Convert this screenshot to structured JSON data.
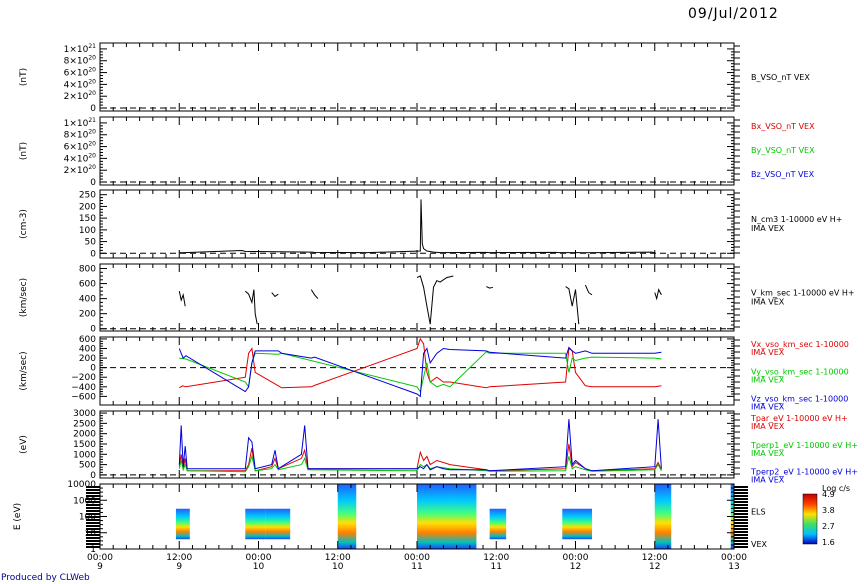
{
  "date": "09/Jul/2012",
  "credit": "Produced by CLWeb",
  "colors": {
    "red": "#e00000",
    "green": "#00c800",
    "blue": "#0000dc",
    "black": "#000000"
  },
  "time_axis": {
    "hours": [
      "00:00",
      "12:00",
      "00:00",
      "12:00",
      "00:00",
      "12:00",
      "00:00",
      "12:00",
      "00:00"
    ],
    "days": [
      "9",
      "9",
      "10",
      "10",
      "11",
      "11",
      "12",
      "12",
      "13"
    ],
    "start": "2012-07-09T00:00",
    "end": "2012-07-13T00:00"
  },
  "chart_data": [
    {
      "type": "line",
      "ylabel": "(nT)",
      "ylim": [
        -5e+19,
        1.1e+21
      ],
      "yticks": [
        {
          "v": 1e+21,
          "base": "1×10",
          "exp": "21"
        },
        {
          "v": 8e+20,
          "base": "8×10",
          "exp": "20"
        },
        {
          "v": 6e+20,
          "base": "6×10",
          "exp": "20"
        },
        {
          "v": 4e+20,
          "base": "4×10",
          "exp": "20"
        },
        {
          "v": 2e+20,
          "base": "2×10",
          "exp": "20"
        },
        {
          "v": 0,
          "base": "0",
          "exp": ""
        }
      ],
      "legend": [
        {
          "name": "B_VSO_nT VEX",
          "color": "black"
        }
      ],
      "series": []
    },
    {
      "type": "line",
      "ylabel": "(nT)",
      "ylim": [
        -5e+19,
        1.1e+21
      ],
      "yticks": [
        {
          "v": 1e+21,
          "base": "1×10",
          "exp": "21"
        },
        {
          "v": 8e+20,
          "base": "8×10",
          "exp": "20"
        },
        {
          "v": 6e+20,
          "base": "6×10",
          "exp": "20"
        },
        {
          "v": 4e+20,
          "base": "4×10",
          "exp": "20"
        },
        {
          "v": 2e+20,
          "base": "2×10",
          "exp": "20"
        },
        {
          "v": 0,
          "base": "0",
          "exp": ""
        }
      ],
      "legend": [
        {
          "name": "Bx_VSO_nT VEX",
          "color": "red"
        },
        {
          "name": "By_VSO_nT VEX",
          "color": "green"
        },
        {
          "name": "Bz_VSO_nT VEX",
          "color": "blue"
        }
      ],
      "series": []
    },
    {
      "type": "line",
      "ylabel": "(cm-3)",
      "ylim": [
        -20,
        270
      ],
      "yticks": [
        {
          "v": 250,
          "base": "250"
        },
        {
          "v": 200,
          "base": "200"
        },
        {
          "v": 150,
          "base": "150"
        },
        {
          "v": 100,
          "base": "100"
        },
        {
          "v": 50,
          "base": "50"
        },
        {
          "v": 0,
          "base": "0"
        }
      ],
      "legend": [
        {
          "name": "N_cm3 1-10000 eV H+",
          "color": "black"
        },
        {
          "name": "IMA VEX",
          "color": "black"
        }
      ],
      "series": [
        {
          "name": "N",
          "color": "black",
          "t": [
            12.0,
            12.3,
            21.5,
            22.0,
            32.0,
            32.5,
            40.0,
            40.5,
            48.5,
            48.6,
            48.8,
            49.0,
            49.5,
            50.5,
            51.5,
            58.5,
            59.0,
            69.0,
            69.5,
            72.5,
            73.0,
            83.5,
            84.0
          ],
          "y": [
            3,
            2,
            12,
            8,
            5,
            4,
            3,
            3,
            10,
            230,
            40,
            20,
            10,
            5,
            3,
            4,
            3,
            4,
            3,
            3,
            2,
            5,
            3
          ]
        }
      ]
    },
    {
      "type": "line",
      "ylabel": "(km/sec)",
      "ylim": [
        -30,
        860
      ],
      "yticks": [
        {
          "v": 800,
          "base": "800"
        },
        {
          "v": 600,
          "base": "600"
        },
        {
          "v": 400,
          "base": "400"
        },
        {
          "v": 200,
          "base": "200"
        },
        {
          "v": 0,
          "base": "0"
        }
      ],
      "legend": [
        {
          "name": "V_km_sec 1-10000 eV H+",
          "color": "black"
        },
        {
          "name": "IMA VEX",
          "color": "black"
        }
      ],
      "series": [
        {
          "name": "V",
          "color": "black",
          "t": [
            12.0,
            12.3,
            12.6,
            12.9
          ],
          "y": [
            500,
            380,
            450,
            300
          ]
        },
        {
          "name": "V",
          "color": "black",
          "t": [
            22.0,
            22.5,
            23.0,
            23.3,
            23.5,
            23.8
          ],
          "y": [
            500,
            460,
            350,
            520,
            200,
            60
          ]
        },
        {
          "name": "V",
          "color": "black",
          "t": [
            26.0,
            26.5,
            27.0
          ],
          "y": [
            480,
            430,
            460
          ]
        },
        {
          "name": "V",
          "color": "black",
          "t": [
            32.0,
            32.5,
            33.0
          ],
          "y": [
            520,
            450,
            400
          ]
        },
        {
          "name": "V",
          "color": "black",
          "t": [
            48.0,
            48.5,
            49.0,
            49.5,
            50.0,
            50.5,
            51.0,
            51.5,
            52.5,
            53.5
          ],
          "y": [
            680,
            700,
            550,
            300,
            60,
            550,
            640,
            620,
            680,
            700
          ]
        },
        {
          "name": "V",
          "color": "black",
          "t": [
            58.5,
            59.0,
            59.5
          ],
          "y": [
            560,
            540,
            550
          ]
        },
        {
          "name": "V",
          "color": "black",
          "t": [
            70.5,
            71.0,
            71.5,
            72.0,
            72.5
          ],
          "y": [
            560,
            530,
            300,
            520,
            60
          ]
        },
        {
          "name": "V",
          "color": "black",
          "t": [
            73.5,
            74.0,
            74.5
          ],
          "y": [
            580,
            480,
            450
          ]
        },
        {
          "name": "V",
          "color": "black",
          "t": [
            84.0,
            84.3,
            84.6,
            85.0
          ],
          "y": [
            480,
            400,
            520,
            450
          ]
        }
      ]
    },
    {
      "type": "line",
      "ylabel": "(km/sec)",
      "ylim": [
        -780,
        640
      ],
      "yticks": [
        {
          "v": 600,
          "base": "600"
        },
        {
          "v": 400,
          "base": "400"
        },
        {
          "v": 200,
          "base": "200"
        },
        {
          "v": 0,
          "base": "0"
        },
        {
          "v": -200,
          "base": "−200"
        },
        {
          "v": -400,
          "base": "−400"
        },
        {
          "v": -600,
          "base": "−600"
        }
      ],
      "legend": [
        {
          "name": "Vx_vso_km_sec 1-10000",
          "color": "red"
        },
        {
          "name": "IMA VEX",
          "color": "red"
        },
        {
          "name": "Vy_vso_km_sec 1-10000",
          "color": "green"
        },
        {
          "name": "IMA VEX",
          "color": "green"
        },
        {
          "name": "Vz_vso_km_sec 1-10000",
          "color": "blue"
        },
        {
          "name": "IMA VEX",
          "color": "blue"
        }
      ],
      "series": [
        {
          "name": "Vx",
          "color": "red",
          "t": [
            12.0,
            12.5,
            13.0,
            22.0,
            22.5,
            23.0,
            23.5,
            27.0,
            27.5,
            32.0,
            32.5,
            48.0,
            48.5,
            49.0,
            49.5,
            50.0,
            51.0,
            52.0,
            53.0,
            58.5,
            59.0,
            70.5,
            71.0,
            71.5,
            72.0,
            73.5,
            74.5,
            84.0,
            85.0
          ],
          "y": [
            -420,
            -380,
            -400,
            -200,
            300,
            400,
            -100,
            -380,
            -420,
            -400,
            -370,
            400,
            600,
            500,
            -100,
            -300,
            -200,
            -300,
            -300,
            -420,
            -400,
            -300,
            400,
            350,
            -100,
            -380,
            -400,
            -400,
            -380
          ]
        },
        {
          "name": "Vy",
          "color": "green",
          "t": [
            12.0,
            13.0,
            22.0,
            22.5,
            23.0,
            23.5,
            27.0,
            27.5,
            48.0,
            48.5,
            49.0,
            49.5,
            50.0,
            51.0,
            52.0,
            53.0,
            58.5,
            59.0,
            70.5,
            71.0,
            71.5,
            72.0,
            73.5,
            74.5,
            84.0,
            85.0
          ],
          "y": [
            200,
            180,
            -300,
            -400,
            100,
            300,
            280,
            300,
            -400,
            -500,
            -200,
            100,
            -300,
            -400,
            -350,
            -400,
            330,
            300,
            300,
            -100,
            200,
            150,
            200,
            220,
            200,
            180
          ]
        },
        {
          "name": "Vz",
          "color": "blue",
          "t": [
            12.0,
            12.3,
            12.6,
            13.0,
            22.0,
            22.5,
            23.0,
            23.5,
            27.0,
            27.5,
            32.0,
            32.5,
            48.0,
            48.5,
            49.0,
            49.5,
            50.0,
            51.0,
            52.0,
            53.0,
            58.5,
            59.0,
            70.5,
            71.0,
            71.5,
            72.0,
            73.5,
            74.5,
            84.0,
            85.0
          ],
          "y": [
            400,
            300,
            200,
            250,
            -500,
            -400,
            100,
            350,
            350,
            300,
            200,
            220,
            -550,
            -600,
            300,
            400,
            100,
            300,
            400,
            380,
            350,
            320,
            200,
            420,
            350,
            300,
            350,
            300,
            300,
            320
          ]
        }
      ]
    },
    {
      "type": "line",
      "ylabel": "(eV)",
      "ylim": [
        -150,
        3100
      ],
      "yticks": [
        {
          "v": 3000,
          "base": "3000"
        },
        {
          "v": 2500,
          "base": "2500"
        },
        {
          "v": 2000,
          "base": "2000"
        },
        {
          "v": 1500,
          "base": "1500"
        },
        {
          "v": 1000,
          "base": "1000"
        },
        {
          "v": 500,
          "base": "500"
        },
        {
          "v": 0,
          "base": "0"
        }
      ],
      "legend": [
        {
          "name": "Tpar_eV 1-10000 eV H+",
          "color": "red"
        },
        {
          "name": "IMA VEX",
          "color": "red"
        },
        {
          "name": "Tperp1_eV 1-10000 eV H+",
          "color": "green"
        },
        {
          "name": "IMA VEX",
          "color": "green"
        },
        {
          "name": "Tperp2_eV 1-10000 eV H+",
          "color": "blue"
        },
        {
          "name": "IMA VEX",
          "color": "blue"
        }
      ],
      "series": [
        {
          "name": "Tpar",
          "color": "red",
          "t": [
            12.0,
            12.3,
            12.6,
            12.9,
            13.2,
            22.0,
            22.5,
            23.0,
            23.5,
            26.0,
            26.5,
            27.0,
            30.5,
            31.0,
            31.5,
            48.0,
            48.5,
            49.0,
            49.5,
            50.0,
            51.0,
            52.0,
            53.0,
            58.5,
            59.0,
            70.5,
            71.0,
            71.5,
            72.0,
            73.5,
            74.5,
            84.0,
            84.5,
            85.0
          ],
          "y": [
            400,
            1000,
            300,
            800,
            200,
            200,
            500,
            1300,
            200,
            400,
            800,
            300,
            800,
            1200,
            300,
            300,
            1100,
            700,
            900,
            500,
            700,
            600,
            500,
            250,
            200,
            300,
            1500,
            400,
            600,
            300,
            200,
            300,
            600,
            250
          ]
        },
        {
          "name": "Tperp1",
          "color": "green",
          "t": [
            12.0,
            12.3,
            12.6,
            12.9,
            13.2,
            22.0,
            22.5,
            23.0,
            23.5,
            26.0,
            26.5,
            27.0,
            30.5,
            31.0,
            31.5,
            48.0,
            48.5,
            49.0,
            49.5,
            50.0,
            51.0,
            52.0,
            53.0,
            58.5,
            59.0,
            70.5,
            71.0,
            71.5,
            72.0,
            73.5,
            74.5,
            84.0,
            84.5,
            85.0
          ],
          "y": [
            300,
            700,
            250,
            500,
            200,
            150,
            400,
            900,
            200,
            300,
            500,
            250,
            500,
            800,
            250,
            200,
            500,
            400,
            500,
            300,
            400,
            350,
            300,
            200,
            180,
            200,
            900,
            300,
            400,
            250,
            180,
            250,
            500,
            200
          ]
        },
        {
          "name": "Tperp2",
          "color": "blue",
          "t": [
            12.0,
            12.3,
            12.6,
            12.9,
            13.2,
            22.0,
            22.5,
            23.0,
            23.5,
            26.0,
            26.5,
            27.0,
            30.5,
            31.0,
            31.5,
            48.0,
            48.5,
            49.0,
            49.5,
            50.0,
            51.0,
            52.0,
            53.0,
            58.5,
            59.0,
            70.5,
            71.0,
            71.5,
            72.0,
            73.5,
            74.5,
            84.0,
            84.5,
            85.0
          ],
          "y": [
            500,
            2400,
            400,
            1400,
            300,
            300,
            1800,
            1600,
            300,
            500,
            1200,
            300,
            1000,
            2400,
            300,
            300,
            400,
            300,
            500,
            250,
            400,
            300,
            250,
            250,
            200,
            400,
            2700,
            500,
            700,
            300,
            200,
            400,
            2700,
            300
          ]
        }
      ]
    },
    {
      "type": "heatmap",
      "ylabel": "E (eV)",
      "ylim": [
        1,
        10000
      ],
      "log": true,
      "yticks": [
        {
          "v": 10000,
          "base": "10000"
        },
        {
          "v": 1000,
          "base": "1000"
        },
        {
          "v": 100,
          "base": "100"
        },
        {
          "v": 10,
          "base": "10"
        },
        {
          "v": 1,
          "base": "1"
        }
      ],
      "legend": [
        {
          "name": "ELS",
          "color": "black"
        },
        {
          "name": "VEX",
          "color": "black"
        }
      ],
      "colorbar": {
        "title": "Log c/s",
        "ticks": [
          "4.9",
          "3.8",
          "2.7",
          "1.6"
        ]
      },
      "blocks": [
        {
          "t0": 11.5,
          "t1": 13.6,
          "e0": 4,
          "e1": 300
        },
        {
          "t0": 22.0,
          "t1": 25.0,
          "e0": 4,
          "e1": 300
        },
        {
          "t0": 25.0,
          "t1": 28.8,
          "e0": 4,
          "e1": 300
        },
        {
          "t0": 36.0,
          "t1": 38.8,
          "e0": 1,
          "e1": 10000
        },
        {
          "t0": 48.0,
          "t1": 53.0,
          "e0": 1,
          "e1": 10000
        },
        {
          "t0": 53.0,
          "t1": 57.0,
          "e0": 1,
          "e1": 10000
        },
        {
          "t0": 59.0,
          "t1": 61.5,
          "e0": 4,
          "e1": 300
        },
        {
          "t0": 70.0,
          "t1": 74.5,
          "e0": 4,
          "e1": 300
        },
        {
          "t0": 84.0,
          "t1": 86.5,
          "e0": 1,
          "e1": 10000
        },
        {
          "t0": 95.5,
          "t1": 96.0,
          "e0": 1,
          "e1": 10000
        }
      ]
    }
  ]
}
